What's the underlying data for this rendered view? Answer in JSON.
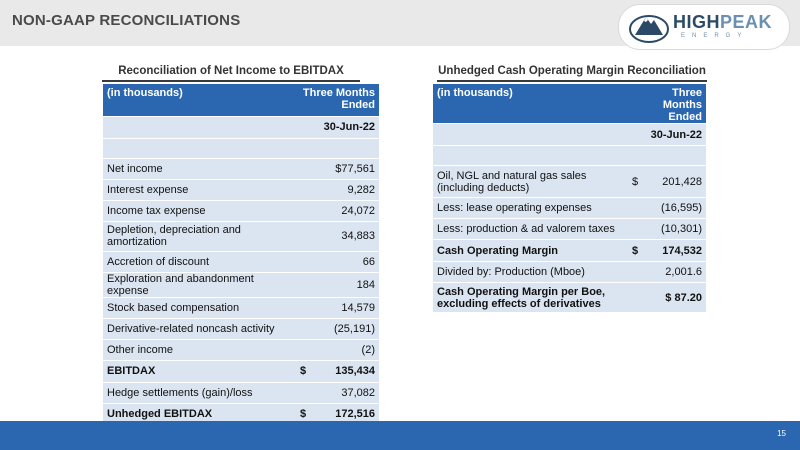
{
  "header": {
    "title": "NON-GAAP RECONCILIATIONS",
    "logo_high": "HIGH",
    "logo_peak": "PEAK",
    "logo_sub": "ENERGY"
  },
  "ebitdax": {
    "title": "Reconciliation of Net Income to EBITDAX",
    "col_label": "(in thousands)",
    "col_period": "Three Months Ended",
    "date": "30-Jun-22",
    "rows": [
      {
        "label": "Net income",
        "value": "$77,561"
      },
      {
        "label": "Interest expense",
        "value": "9,282"
      },
      {
        "label": "Income tax expense",
        "value": "24,072"
      },
      {
        "label": "Depletion, depreciation and amortization",
        "value": "34,883"
      },
      {
        "label": "Accretion of discount",
        "value": "66"
      },
      {
        "label": "Exploration and abandonment expense",
        "value": "184"
      },
      {
        "label": "Stock based compensation",
        "value": "14,579"
      },
      {
        "label": "Derivative-related noncash activity",
        "value": "(25,191)"
      },
      {
        "label": "Other income",
        "value": "(2)"
      },
      {
        "label": "EBITDAX",
        "currency": "$",
        "value": "135,434"
      },
      {
        "label": "Hedge settlements (gain)/loss",
        "value": "37,082"
      },
      {
        "label": "Unhedged EBITDAX",
        "currency": "$",
        "value": "172,516"
      }
    ]
  },
  "margin": {
    "title": "Unhedged Cash Operating Margin Reconciliation",
    "col_label": "(in thousands)",
    "col_period": "Three Months Ended",
    "date": "30-Jun-22",
    "rows": [
      {
        "label": "Oil, NGL and natural gas sales (including deducts)",
        "currency": "$",
        "value": "201,428"
      },
      {
        "label": "Less: lease operating expenses",
        "value": "(16,595)"
      },
      {
        "label": "Less: production & ad valorem taxes",
        "value": "(10,301)"
      },
      {
        "label": "Cash Operating Margin",
        "currency": "$",
        "value": "174,532"
      },
      {
        "label": "Divided by: Production (Mboe)",
        "value": "2,001.6"
      },
      {
        "label": "Cash Operating Margin per Boe, excluding effects of derivatives",
        "value": "$ 87.20"
      }
    ]
  },
  "footer": {
    "page_number": "15"
  }
}
